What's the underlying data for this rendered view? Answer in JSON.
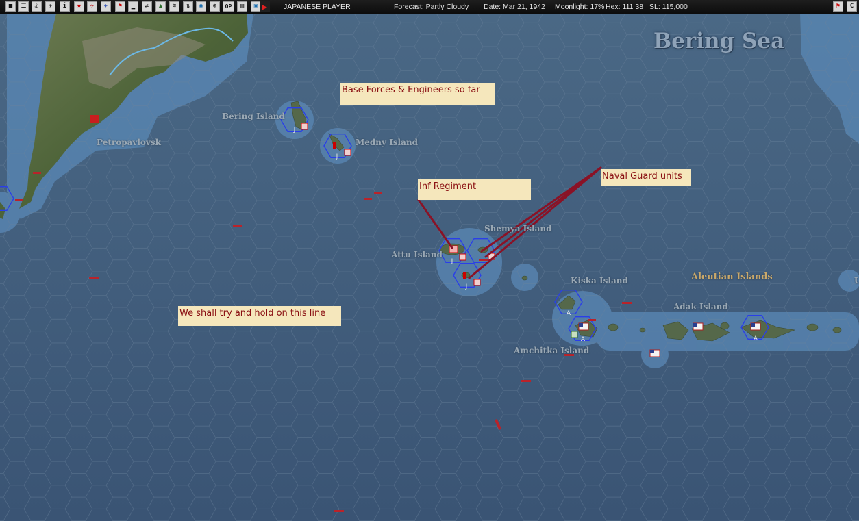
{
  "toolbar": {
    "player": "JAPANESE PLAYER",
    "forecast": "Forecast: Partly Cloudy",
    "date": "Date: Mar 21, 1942",
    "moonlight": "Moonlight: 17%",
    "hex": "Hex: 111 38",
    "sl": "SL: 115,000",
    "buttons": [
      "square-icon",
      "document-icon",
      "ship-group-icon",
      "aircraft-group-icon",
      "info-icon",
      "burst-icon",
      "plane-red-icon",
      "plane-blue-icon",
      "flag-icon",
      "sub-icon",
      "transfer-icon",
      "base-icon",
      "convoy-icon",
      "exchange-icon",
      "globe-icon",
      "target-icon",
      "op-icon",
      "list-icon",
      "window-icon"
    ],
    "op_label": "OP",
    "info_label": "i",
    "right_buttons": [
      "report-icon",
      "close-icon"
    ],
    "right_close_label": "C"
  },
  "map": {
    "sea_color": "#42607f",
    "places": {
      "bering_sea": "Bering Sea",
      "bering_island": "Bering Island",
      "medny_island": "Medny Island",
      "petropavlovsk": "Petropavlovsk",
      "shemya_island": "Shemya Island",
      "attu_island": "Attu Island",
      "kiska_island": "Kiska Island",
      "aleutian_islands": "Aleutian Islands",
      "adak_island": "Adak Island",
      "amchitka_island": "Amchitka Island",
      "edge_u": "U"
    },
    "hex_markers": {
      "japan": "J",
      "allied": "A"
    },
    "notes": {
      "base_forces": "Base Forces & Engineers so far",
      "inf_regiment": "Inf Regiment",
      "naval_guard": "Naval Guard units",
      "hold_line": "We shall try and hold on this line"
    }
  }
}
